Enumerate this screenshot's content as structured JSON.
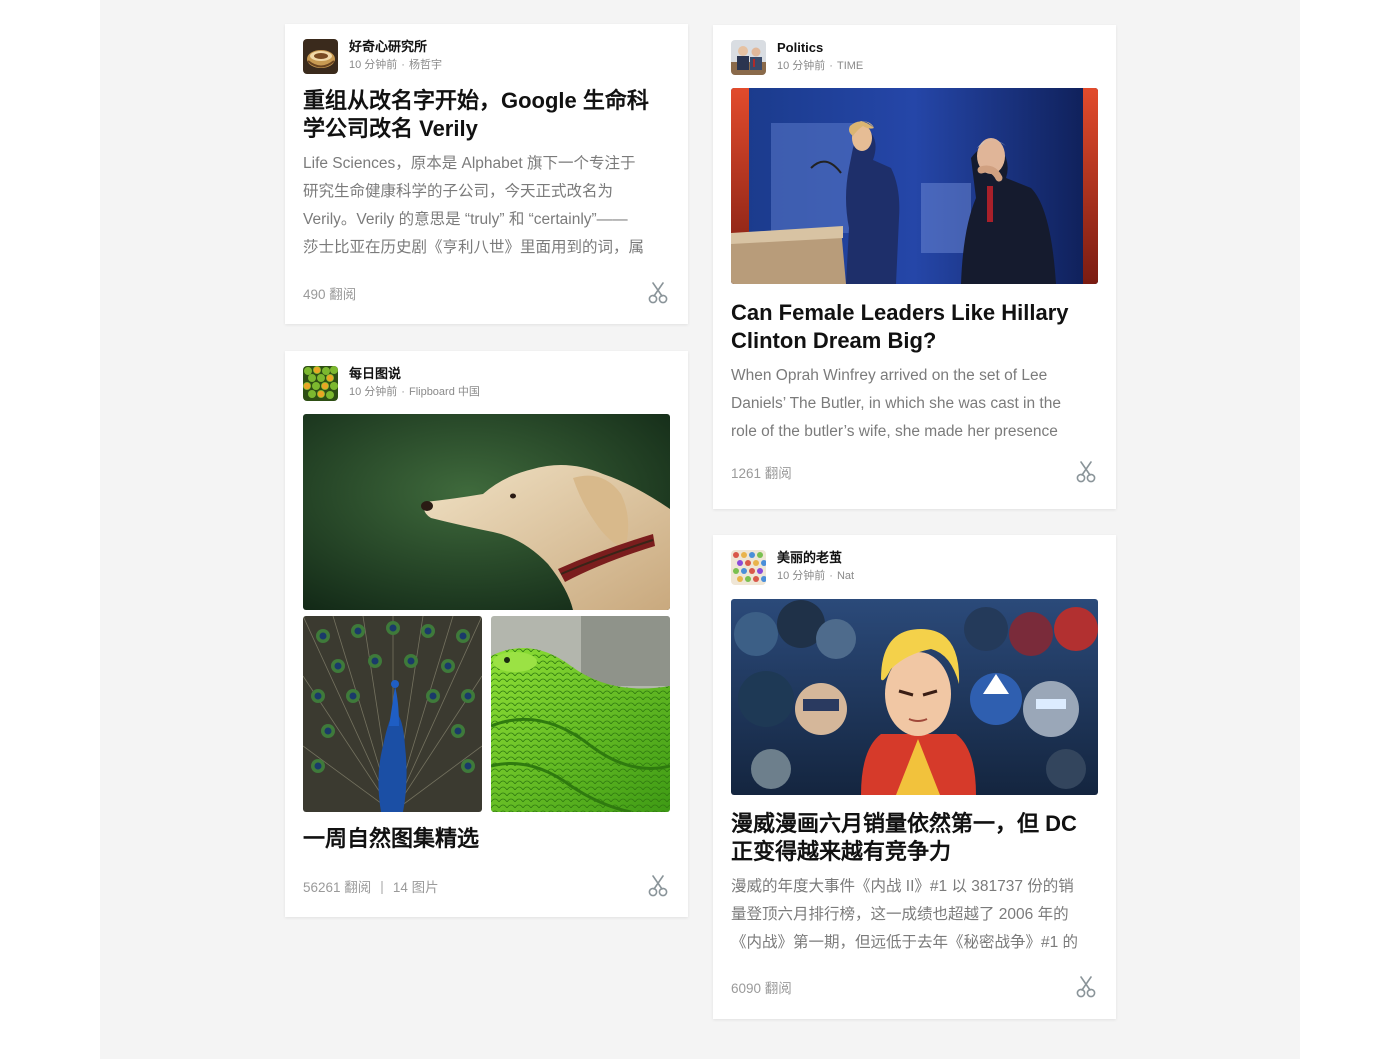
{
  "cards": [
    {
      "section": "好奇心研究所",
      "time": "10 分钟前",
      "source": "杨哲宇",
      "headline_line1": "重组从改名字开始，Google 生命科",
      "headline_line2": "学公司改名 Verily",
      "excerpt": [
        "Life Sciences，原本是 Alphabet 旗下一个专注于",
        "研究生命健康科学的子公司，今天正式改名为",
        "Verily。Verily 的意思是 “truly” 和 “certainly”——",
        "莎士比亚在历史剧《亨利八世》里面用到的词，属"
      ],
      "flips": "490 翻阅",
      "avatar_icon": "bowl-icon"
    },
    {
      "section": "每日图说",
      "time": "10 分钟前",
      "source": "Flipboard 中国",
      "headline": "一周自然图集精选",
      "flips": "56261 翻阅",
      "separator": "|",
      "photo_count": "14 图片",
      "images": [
        "dog-photo",
        "peacock-photo",
        "green-snake-photo"
      ],
      "avatar_icon": "green-peas-icon"
    },
    {
      "section": "Politics",
      "time": "10 分钟前",
      "source": "TIME",
      "headline_line1": "Can Female Leaders Like Hillary",
      "headline_line2": "Clinton Dream Big?",
      "excerpt": [
        "When Oprah Winfrey arrived on the set of Lee",
        "Daniels’ The Butler, in which she was cast in the",
        "role of the butler’s wife, she made her presence"
      ],
      "flips": "1261 翻阅",
      "image": "podium-speech-photo",
      "avatar_icon": "politician-icon"
    },
    {
      "section": "美丽的老茧",
      "time": "10 分钟前",
      "source": "Nat",
      "headline_line1": "漫威漫画六月销量依然第一，但 DC",
      "headline_line2": "正变得越来越有竞争力",
      "excerpt": [
        "漫威的年度大事件《内战 II》#1 以 381737 份的销",
        "量登顶六月排行榜，这一成绩也超越了 2006 年的",
        "《内战》第一期，但远低于去年《秘密战争》#1 的"
      ],
      "flips": "6090 翻阅",
      "image": "comic-heroes-photo",
      "avatar_icon": "colorful-pattern-icon"
    }
  ],
  "byline_dot": "·",
  "clip_icon": "scissors-icon",
  "colors": {
    "background": "#f4f4f4",
    "card": "#ffffff",
    "muted_text": "#7b7b7b",
    "icon": "#8a9499"
  }
}
